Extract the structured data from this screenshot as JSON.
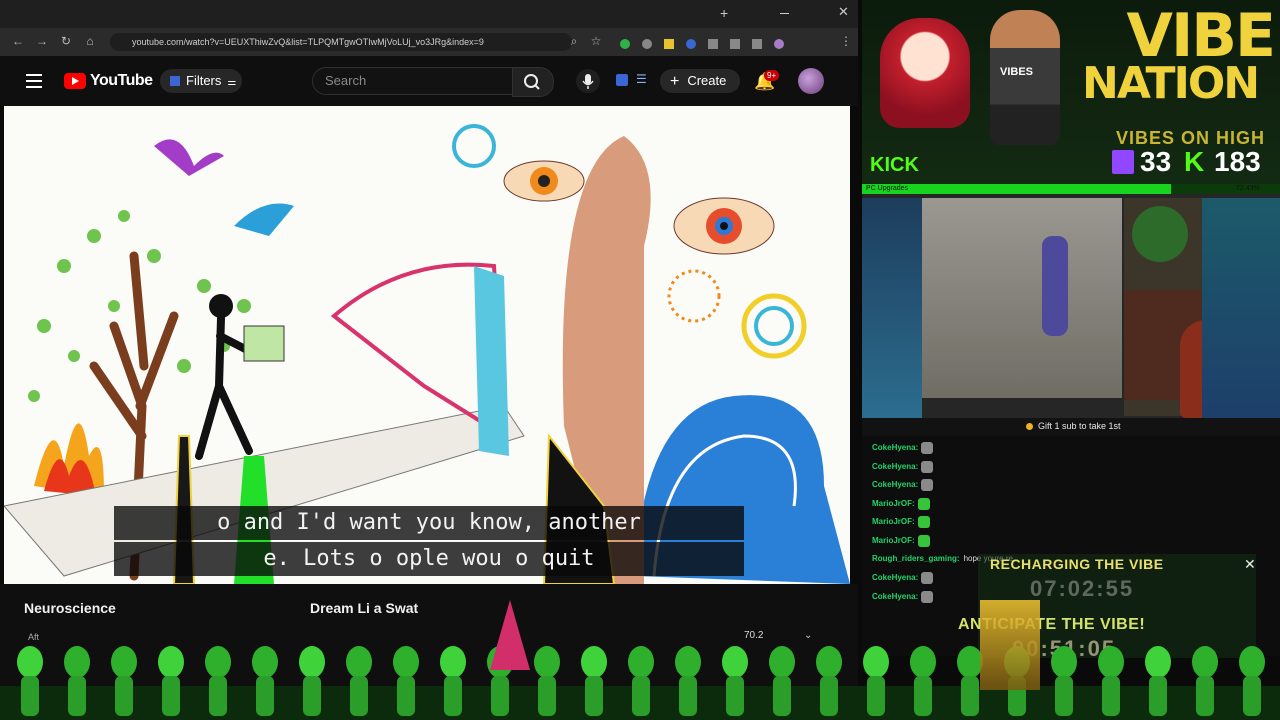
{
  "browser": {
    "url": "youtube.com/watch?v=UEUXThiwZvQ&list=TLPQMTgwOTIwMjVoLUj_vo3JRg&index=9",
    "tab_colors": [
      "#e9c12e",
      "#9aa0a6",
      "#7d4ed8",
      "#e44a3a",
      "#e44a3a",
      "#e44a3a",
      "#e44a3a",
      "#e44a3a",
      "#e44a3a",
      "#e44a3a",
      "#e44a3a",
      "#e44a3a",
      "#e44a3a",
      "#e44a3a",
      "#e44a3a",
      "#e44a3a",
      "#e44a3a",
      "#e44a3a",
      "#e44a3a",
      "#3aa74a",
      "#e44a3a",
      "#4a7ad8",
      "#e44a3a",
      "#e44a3a"
    ],
    "new_tab": "+"
  },
  "youtube": {
    "wordmark": "YouTube",
    "filters_label": "Filters",
    "search_placeholder": "Search",
    "create_label": "Create",
    "notif_count": "9+"
  },
  "video": {
    "caption_line1": "o    and I'd want you know,     another",
    "caption_line2": "e. Lots o   ople wou        o quit",
    "title_left": "Neuroscience",
    "title_right": "Dream Li        a Swat",
    "channel_hint": "Aft",
    "count_label": "70.2"
  },
  "stream": {
    "brand_line1": "VIBE",
    "brand_line2": "NATION",
    "tagline": "VIBES ON HIGH",
    "kick_label": "KICK",
    "stat_a": "33",
    "stat_k": "K",
    "stat_b": "183",
    "progress_label": "PC Upgrades",
    "progress_pct": "72.43%",
    "progress_fraction": 0.74,
    "gift_text": "Gift 1 sub to take 1st",
    "recharging_label": "RECHARGING THE VIBE",
    "timer1": "07:02:55",
    "anticipate_label": "ANTICIPATE THE VIBE!",
    "timer2": "00:51:05",
    "close_glyph": "✕"
  },
  "chat": [
    {
      "user": "CokeHyena:",
      "msg": "",
      "emote": "#8a8a8a"
    },
    {
      "user": "CokeHyena:",
      "msg": "",
      "emote": "#8a8a8a"
    },
    {
      "user": "CokeHyena:",
      "msg": "",
      "emote": "#8a8a8a"
    },
    {
      "user": "MarioJrOF:",
      "msg": "",
      "emote": "#37c43a"
    },
    {
      "user": "MarioJrOF:",
      "msg": "",
      "emote": "#37c43a"
    },
    {
      "user": "MarioJrOF:",
      "msg": "",
      "emote": "#37c43a"
    },
    {
      "user": "Rough_riders_gaming:",
      "msg": "hope youre re",
      "emote": ""
    },
    {
      "user": "CokeHyena:",
      "msg": "",
      "emote": "#8a8a8a"
    },
    {
      "user": "CokeHyena:",
      "msg": "",
      "emote": "#8a8a8a"
    }
  ],
  "colors": {
    "youtube_red": "#ff0000",
    "kick_green": "#53fc18",
    "twitch_purple": "#9146ff",
    "vibe_yellow": "#f0d23c"
  }
}
